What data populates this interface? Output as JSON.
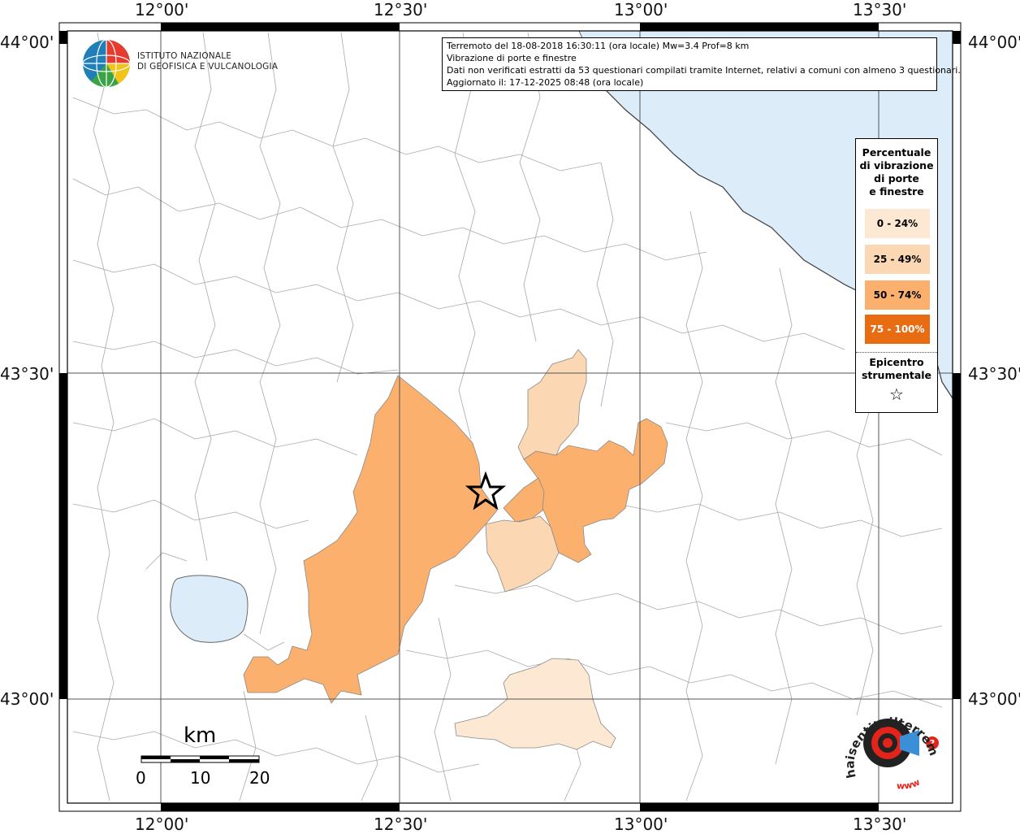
{
  "map": {
    "lon_labels": [
      "12°00'",
      "12°30'",
      "13°00'",
      "13°30'"
    ],
    "lat_labels": [
      "44°00'",
      "43°30'",
      "43°00'"
    ],
    "lon_range": [
      "11°50'",
      "13°38'"
    ],
    "lat_range": [
      "42°48'",
      "44°02'"
    ],
    "colors": {
      "sea": "#dcecf9",
      "c0_24": "#fde9d3",
      "c25_49": "#fcd7b3",
      "c50_74": "#fbb06d",
      "c75_100": "#e86d12",
      "boundary": "#9a9a9a",
      "grid": "#555555"
    }
  },
  "info": {
    "line1": "Terremoto del 18-08-2018 16:30:11 (ora locale) Mw=3.4 Prof=8 km",
    "line2": "Vibrazione di porte e finestre",
    "line3": "Dati non verificati estratti da 53 questionari compilati tramite Internet, relativi a comuni con almeno 3 questionari.",
    "line4": "Aggiornato il: 17-12-2025 08:48 (ora locale)"
  },
  "logo": {
    "line1": "ISTITUTO NAZIONALE",
    "line2": "DI GEOFISICA E VULCANOLOGIA"
  },
  "legend": {
    "title_l1": "Percentuale",
    "title_l2": "di vibrazione",
    "title_l3": "di porte",
    "title_l4": "e finestre",
    "items": [
      "0 - 24%",
      "25 - 49%",
      "50 - 74%",
      "75 - 100%"
    ],
    "epi_l1": "Epicentro",
    "epi_l2": "strumentale",
    "epi_symbol": "☆"
  },
  "scale": {
    "unit": "km",
    "ticks": [
      "0",
      "10",
      "20"
    ]
  },
  "watermark": {
    "text": "haisentitoilterremoto.it",
    "url": "www"
  }
}
